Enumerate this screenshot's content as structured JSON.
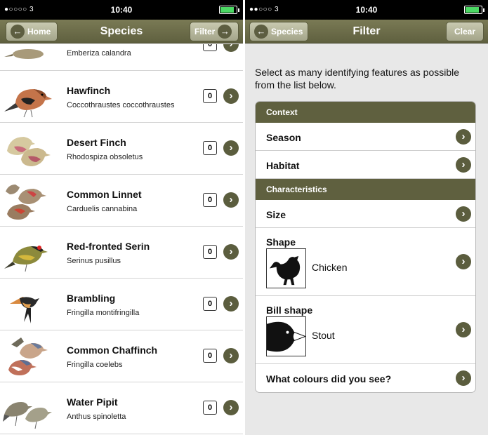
{
  "status_left": {
    "carrier": "●○○○○ 3 ",
    "time": "10:40"
  },
  "status_right": {
    "carrier": "●●○○○ 3 ",
    "time": "10:40"
  },
  "species_screen": {
    "title": "Species",
    "back_button": "Home",
    "filter_button": "Filter",
    "items": [
      {
        "name": "",
        "latin": "Emberiza calandra",
        "count": "0"
      },
      {
        "name": "Hawfinch",
        "latin": "Coccothraustes coccothraustes",
        "count": "0"
      },
      {
        "name": "Desert Finch",
        "latin": "Rhodospiza obsoletus",
        "count": "0"
      },
      {
        "name": "Common Linnet",
        "latin": "Carduelis cannabina",
        "count": "0"
      },
      {
        "name": "Red-fronted Serin",
        "latin": "Serinus pusillus",
        "count": "0"
      },
      {
        "name": "Brambling",
        "latin": "Fringilla montifringilla",
        "count": "0"
      },
      {
        "name": "Common Chaffinch",
        "latin": "Fringilla coelebs",
        "count": "0"
      },
      {
        "name": "Water Pipit",
        "latin": "Anthus spinoletta",
        "count": "0"
      }
    ]
  },
  "filter_screen": {
    "title": "Filter",
    "back_button": "Species",
    "clear_button": "Clear",
    "intro": "Select as many identifying features as possible from the list below.",
    "context_header": "Context",
    "season": "Season",
    "habitat": "Habitat",
    "characteristics_header": "Characteristics",
    "size": "Size",
    "shape_label": "Shape",
    "shape_value": "Chicken",
    "bill_label": "Bill shape",
    "bill_value": "Stout",
    "colours": "What colours did you see?"
  },
  "colors": {
    "nav": "#5f603f",
    "accent": "#5b5d3e",
    "battery": "#4cd964"
  }
}
